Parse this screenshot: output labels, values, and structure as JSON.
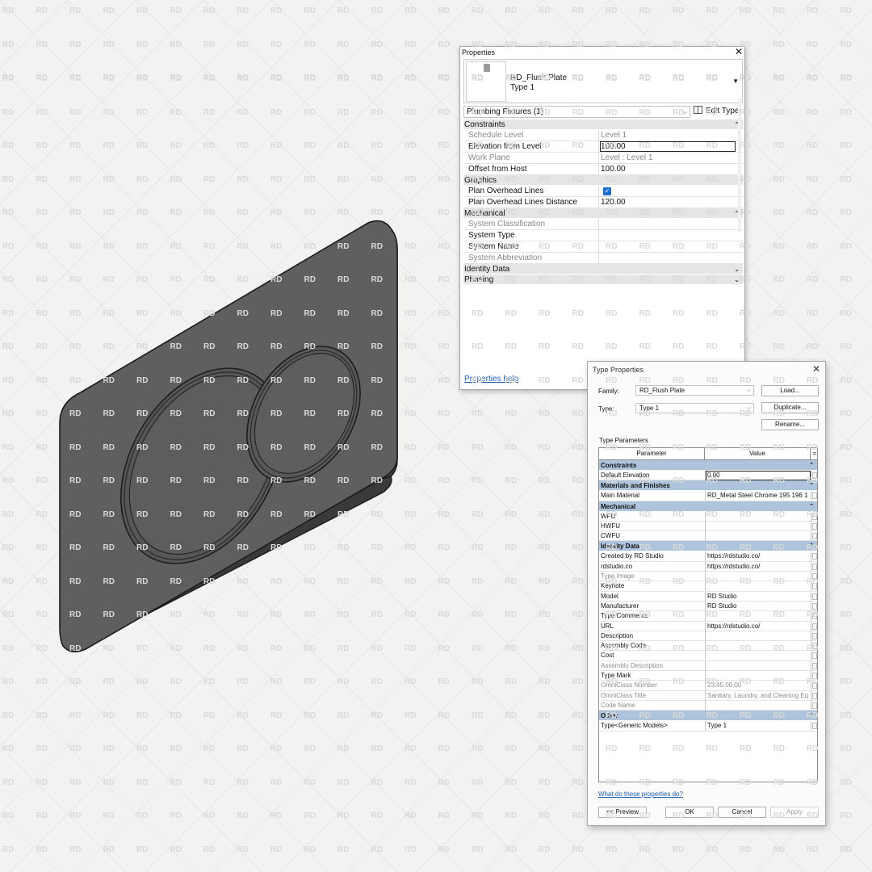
{
  "watermark": "RD",
  "properties": {
    "title": "Properties",
    "close": "✕",
    "family_name": "RD_Flush Plate",
    "type_name": "Type 1",
    "filter_label": "Plumbing Fixtures (1)",
    "edit_type_label": "Edit Type",
    "help_link": "Properties help",
    "groups": {
      "constraints": "Constraints",
      "graphics": "Graphics",
      "mechanical": "Mechanical",
      "identity": "Identity Data",
      "phasing": "Phasing"
    },
    "rows": {
      "schedule_level": {
        "label": "Schedule Level",
        "value": "Level 1"
      },
      "elevation_from_level": {
        "label": "Elevation from Level",
        "value": "100.00"
      },
      "work_plane": {
        "label": "Work Plane",
        "value": "Level : Level 1"
      },
      "offset_from_host": {
        "label": "Offset from Host",
        "value": "100.00"
      },
      "plan_overhead_lines": {
        "label": "Plan Overhead Lines",
        "checked": true
      },
      "plan_overhead_lines_distance": {
        "label": "Plan Overhead Lines Distance",
        "value": "120.00"
      },
      "system_classification": {
        "label": "System Classification",
        "value": ""
      },
      "system_type": {
        "label": "System Type",
        "value": ""
      },
      "system_name": {
        "label": "System Name",
        "value": ""
      },
      "system_abbreviation": {
        "label": "System Abbreviation",
        "value": ""
      }
    }
  },
  "type_properties": {
    "title": "Type Properties",
    "close": "✕",
    "family_label": "Family:",
    "family_value": "RD_Flush Plate",
    "type_label": "Type:",
    "type_value": "Type 1",
    "buttons": {
      "load": "Load...",
      "duplicate": "Duplicate...",
      "rename": "Rename...",
      "preview": "<< Preview",
      "ok": "OK",
      "cancel": "Cancel",
      "apply": "Apply"
    },
    "section_label": "Type Parameters",
    "columns": {
      "parameter": "Parameter",
      "value": "Value",
      "eq": "="
    },
    "what_link": "What do these properties do?",
    "groups": {
      "constraints": "Constraints",
      "materials": "Materials and Finishes",
      "mechanical": "Mechanical",
      "identity": "Identity Data",
      "other": "Other"
    },
    "rows": {
      "default_elevation": {
        "label": "Default Elevation",
        "value": "0.00"
      },
      "main_material": {
        "label": "Main Material",
        "value": "RD_Metal Steel Chrome 195 196 1"
      },
      "wfu": {
        "label": "WFU",
        "value": ""
      },
      "hwfu": {
        "label": "HWFU",
        "value": ""
      },
      "cwfu": {
        "label": "CWFU",
        "value": ""
      },
      "created_by": {
        "label": "Created by RD Studio",
        "value": "https://rdstudio.co/"
      },
      "rdstudio": {
        "label": "rdstudio.co",
        "value": "https://rdstudio.co/"
      },
      "type_image": {
        "label": "Type Image",
        "value": ""
      },
      "keynote": {
        "label": "Keynote",
        "value": ""
      },
      "model": {
        "label": "Model",
        "value": "RD Studio"
      },
      "manufacturer": {
        "label": "Manufacturer",
        "value": "RD Studio"
      },
      "type_comments": {
        "label": "Type Comments",
        "value": ""
      },
      "url": {
        "label": "URL",
        "value": "https://rdstudio.co/"
      },
      "description": {
        "label": "Description",
        "value": ""
      },
      "assembly_code": {
        "label": "Assembly Code",
        "value": ""
      },
      "cost": {
        "label": "Cost",
        "value": ""
      },
      "assembly_description": {
        "label": "Assembly Description",
        "value": ""
      },
      "type_mark": {
        "label": "Type Mark",
        "value": ""
      },
      "omniclass_number": {
        "label": "OmniClass Number",
        "value": "23.45.00.00"
      },
      "omniclass_title": {
        "label": "OmniClass Title",
        "value": "Sanitary, Laundry, and Cleaning Eq"
      },
      "code_name": {
        "label": "Code Name",
        "value": ""
      },
      "type_generic": {
        "label": "Type<Generic Models>",
        "value": "Type 1"
      }
    }
  },
  "icons": {
    "close": "close-icon",
    "dropdown": "chevron-down-icon",
    "collapse": "collapse-icon",
    "expand": "expand-icon",
    "edit_type": "edit-type-icon",
    "checkbox": "checkbox-icon"
  },
  "colors": {
    "background": "#f2f2f0",
    "plate": "#5e5e5e",
    "group_header_type": "#aec4dc",
    "group_header_props": "#e5e5e5",
    "link": "#1a5fb4",
    "checkbox": "#1f6fd0"
  }
}
